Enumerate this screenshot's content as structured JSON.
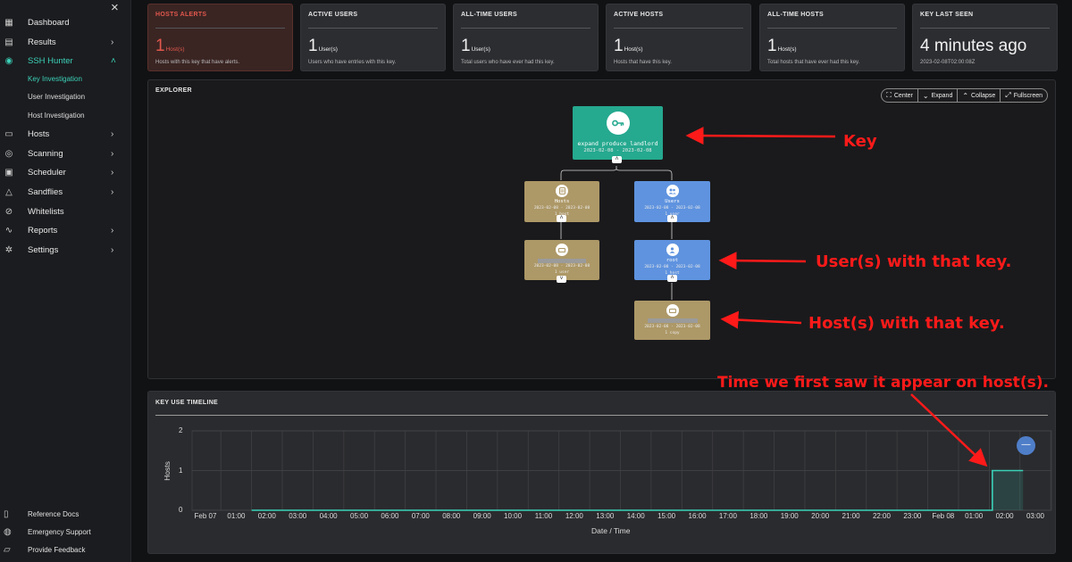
{
  "sidebar": {
    "close_icon": "×",
    "items": [
      {
        "label": "Dashboard",
        "icon": "dashboard-icon",
        "glyph": "▦",
        "chevron": ""
      },
      {
        "label": "Results",
        "icon": "results-icon",
        "glyph": "▤",
        "chevron": "›"
      },
      {
        "label": "SSH Hunter",
        "icon": "ssh-hunter-icon",
        "glyph": "◉",
        "chevron": "˄"
      },
      {
        "label": "Hosts",
        "icon": "hosts-icon",
        "glyph": "▭",
        "chevron": "›"
      },
      {
        "label": "Scanning",
        "icon": "scanning-icon",
        "glyph": "◎",
        "chevron": "›"
      },
      {
        "label": "Scheduler",
        "icon": "calendar-icon",
        "glyph": "▣",
        "chevron": "›"
      },
      {
        "label": "Sandflies",
        "icon": "sandflies-icon",
        "glyph": "△",
        "chevron": "›"
      },
      {
        "label": "Whitelists",
        "icon": "whitelist-icon",
        "glyph": "⊘",
        "chevron": ""
      },
      {
        "label": "Reports",
        "icon": "reports-icon",
        "glyph": "∿",
        "chevron": "›"
      },
      {
        "label": "Settings",
        "icon": "gear-icon",
        "glyph": "✲",
        "chevron": "›"
      }
    ],
    "subitems": [
      "Key Investigation",
      "User Investigation",
      "Host Investigation"
    ],
    "footer": [
      {
        "label": "Reference Docs",
        "icon": "book-icon",
        "glyph": "▯"
      },
      {
        "label": "Emergency Support",
        "icon": "support-icon",
        "glyph": "◍"
      },
      {
        "label": "Provide Feedback",
        "icon": "feedback-icon",
        "glyph": "▱"
      }
    ]
  },
  "cards": [
    {
      "title": "HOSTS ALERTS",
      "value": "1",
      "unit": "Host(s)",
      "desc": "Hosts with this key that have alerts."
    },
    {
      "title": "ACTIVE USERS",
      "value": "1",
      "unit": "User(s)",
      "desc": "Users who have entries with this key."
    },
    {
      "title": "ALL-TIME USERS",
      "value": "1",
      "unit": "User(s)",
      "desc": "Total users who have ever had this key."
    },
    {
      "title": "ACTIVE HOSTS",
      "value": "1",
      "unit": "Host(s)",
      "desc": "Hosts that have this key."
    },
    {
      "title": "ALL-TIME HOSTS",
      "value": "1",
      "unit": "Host(s)",
      "desc": "Total hosts that have ever had this key."
    },
    {
      "title": "KEY LAST SEEN",
      "value": "4 minutes ago",
      "unit": "",
      "desc": "2023-02-08T02:00:08Z"
    }
  ],
  "explorer": {
    "title": "EXPLORER",
    "toolbar": [
      {
        "label": "Center",
        "glyph": "⛶"
      },
      {
        "label": "Expand",
        "glyph": "⌄"
      },
      {
        "label": "Collapse",
        "glyph": "⌃"
      },
      {
        "label": "Fullscreen",
        "glyph": "⤢"
      }
    ],
    "key_node": {
      "name": "expand produce landlord",
      "dates": "2023-02-08 - 2023-02-08"
    },
    "hosts_node": {
      "name": "Hosts",
      "dates": "2023-02-08 - 2023-02-08",
      "count": "1 host"
    },
    "users_node": {
      "name": "Users",
      "dates": "2023-02-08 - 2023-02-08",
      "count": "1 user"
    },
    "host_leaf": {
      "dates": "2023-02-08 - 2023-02-08",
      "count": "1 user"
    },
    "root_node": {
      "name": "root",
      "dates": "2023-02-08 - 2023-02-08",
      "count": "1 host"
    },
    "host_leaf2": {
      "dates": "2023-02-08 - 2023-02-08",
      "count": "1 copy"
    }
  },
  "annotations": {
    "key": "Key",
    "users": "User(s) with that key.",
    "hosts": "Host(s) with that key.",
    "time": "Time we first saw it appear on host(s)."
  },
  "timeline": {
    "title": "KEY USE TIMELINE",
    "fab": "—"
  },
  "chart_data": {
    "type": "area",
    "title": "KEY USE TIMELINE",
    "xlabel": "Date / Time",
    "ylabel": "Hosts",
    "x_ticks": [
      "Feb 07",
      "01:00",
      "02:00",
      "03:00",
      "04:00",
      "05:00",
      "06:00",
      "07:00",
      "08:00",
      "09:00",
      "10:00",
      "11:00",
      "12:00",
      "13:00",
      "14:00",
      "15:00",
      "16:00",
      "17:00",
      "18:00",
      "19:00",
      "20:00",
      "21:00",
      "22:00",
      "23:00",
      "Feb 08",
      "01:00",
      "02:00",
      "03:00"
    ],
    "y_ticks": [
      "0",
      "1",
      "2"
    ],
    "ylim": [
      0,
      2
    ],
    "x_hours": [
      1.5,
      25.6,
      25.6,
      26.6
    ],
    "values": [
      0,
      0,
      1,
      1
    ],
    "color": "#3bd1b9",
    "grid": true
  }
}
